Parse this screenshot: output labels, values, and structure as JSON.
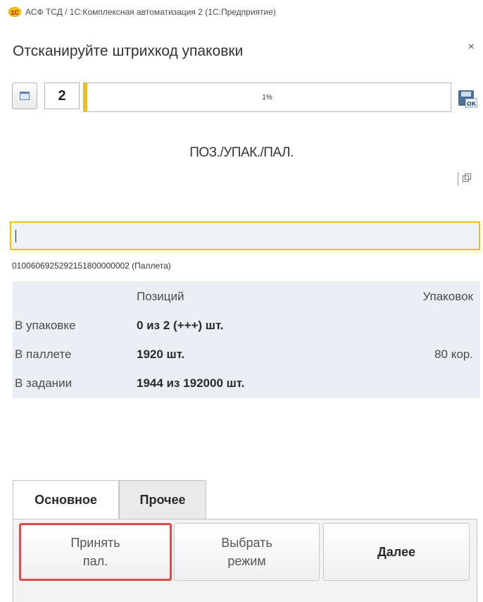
{
  "window": {
    "logo_text": "1С",
    "title": "АСФ ТСД / 1С:Комплексная автоматизация 2  (1С:Предприятие)"
  },
  "form": {
    "title": "Отсканируйте штрихкод упаковки",
    "close_label": "×"
  },
  "toolbar": {
    "count_value": "2",
    "progress_text": "1%",
    "progress_fraction": 0.01,
    "calendar_icon": "calendar-icon",
    "save_ok_icon": "save-ok-icon"
  },
  "section": {
    "title": "ПОЗ./УПАК./ПАЛ."
  },
  "scan": {
    "value": "",
    "barcode_info": "0100606925292151800000002 (Паллета)"
  },
  "info": {
    "header": {
      "col2": "Позиций",
      "col3": "Упаковок"
    },
    "rows": [
      {
        "label": "В упаковке",
        "positions": "0 из 2  (+++) шт.",
        "packs": ""
      },
      {
        "label": "В паллете",
        "positions": "1920 шт.",
        "packs": "80 кор."
      },
      {
        "label": "В задании",
        "positions": "1944 из 192000 шт.",
        "packs": ""
      }
    ]
  },
  "tabs": [
    {
      "label": "Основное"
    },
    {
      "label": "Прочее"
    }
  ],
  "buttons": [
    {
      "line1": "Принять",
      "line2": "пал."
    },
    {
      "line1": "Выбрать",
      "line2": "режим"
    },
    {
      "line1": "Далее",
      "line2": ""
    }
  ],
  "colors": {
    "accent_yellow": "#f2c200",
    "highlight_red": "#e04a4a",
    "info_bg": "#e9eff5"
  }
}
